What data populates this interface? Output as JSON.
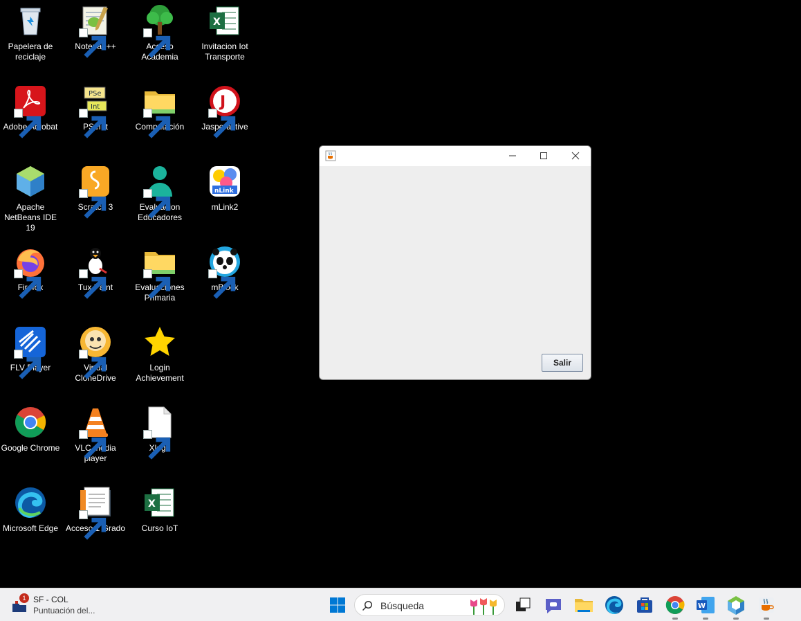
{
  "desktop": {
    "icons": [
      {
        "label": "Papelera de reciclaje"
      },
      {
        "label": "Notepad++"
      },
      {
        "label": "Acceso Academia"
      },
      {
        "label": "Invitacion Iot Transporte"
      },
      {
        "label": "Adobe Acrobat"
      },
      {
        "label": "PSeInt"
      },
      {
        "label": "Computación"
      },
      {
        "label": "Jasperactive"
      },
      {
        "label": "Apache NetBeans IDE 19"
      },
      {
        "label": "Scratch 3"
      },
      {
        "label": "Evaluacion Educadores"
      },
      {
        "label": "mLink2"
      },
      {
        "label": "Firefox"
      },
      {
        "label": "Tux Paint"
      },
      {
        "label": "Evaluaciones Primaria"
      },
      {
        "label": "mBlock"
      },
      {
        "label": "FLV Player"
      },
      {
        "label": "Virtual CloneDrive"
      },
      {
        "label": "Login Achievement"
      },
      {
        "label": "Google Chrome"
      },
      {
        "label": "VLC media player"
      },
      {
        "label": "Xlogo"
      },
      {
        "label": "Microsoft Edge"
      },
      {
        "label": "Acceso 1 Grado"
      },
      {
        "label": "Curso IoT"
      }
    ]
  },
  "window": {
    "title": "",
    "exit_button": "Salir"
  },
  "taskbar": {
    "widget_badge": "1",
    "widget_title": "SF - COL",
    "widget_subtitle": "Puntuación del...",
    "search_placeholder": "Búsqueda",
    "apps": [
      "start-icon",
      "task-view-icon",
      "teams-chat-icon",
      "file-explorer-icon",
      "edge-icon",
      "microsoft-store-icon",
      "chrome-icon",
      "word-icon",
      "netbeans-icon",
      "java-icon"
    ]
  },
  "colors": {
    "desktop_background": "#000000",
    "taskbar_background": "#f0f0f2",
    "window_background": "#eeeeee",
    "start_blue": "#0078d4"
  }
}
